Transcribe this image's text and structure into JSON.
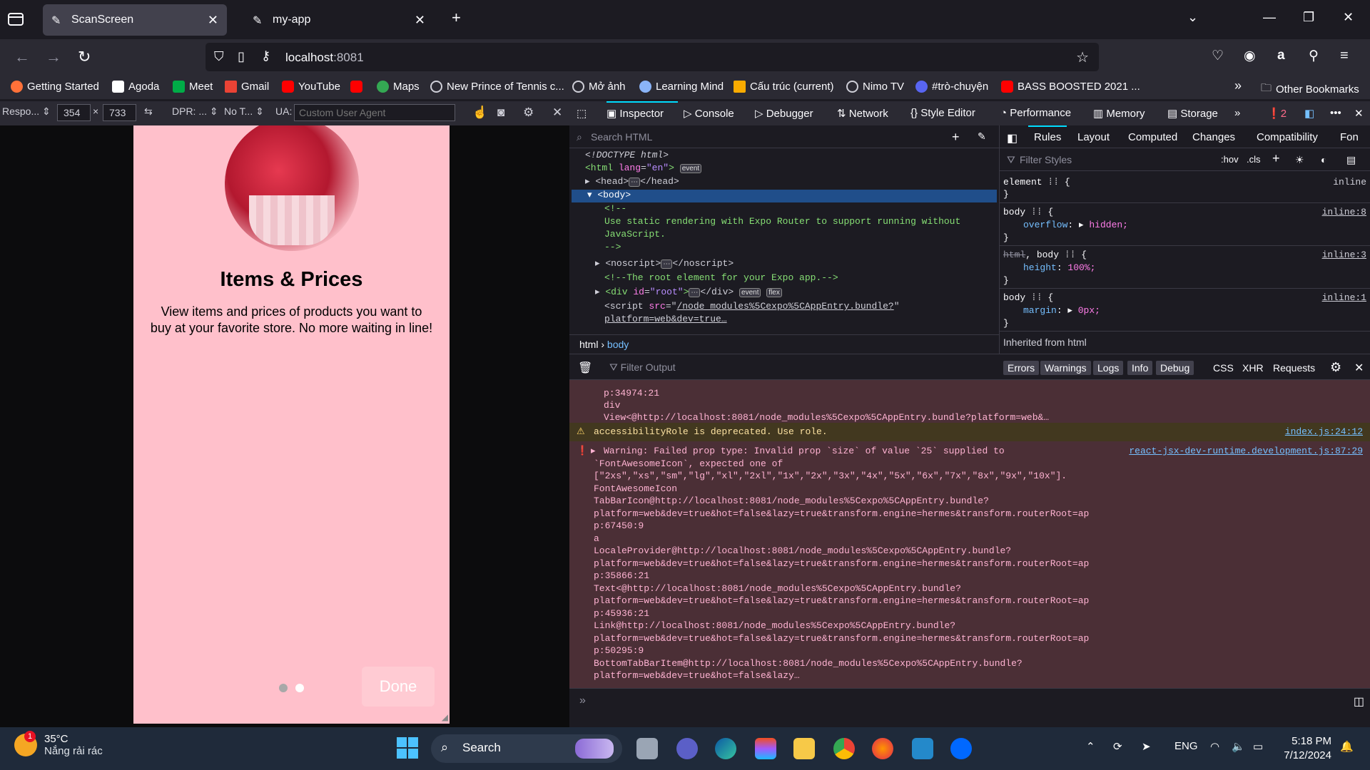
{
  "tabs": [
    {
      "title": "ScanScreen",
      "active": true
    },
    {
      "title": "my-app",
      "active": false
    }
  ],
  "address": {
    "host": "localhost",
    "port": ":8081"
  },
  "bookmarks": [
    {
      "label": "Getting Started",
      "color": "#ff7139"
    },
    {
      "label": "Agoda",
      "color": "#ffffff"
    },
    {
      "label": "Meet",
      "color": "#00ac47"
    },
    {
      "label": "Gmail",
      "color": "#ea4335"
    },
    {
      "label": "YouTube",
      "color": "#ff0000"
    },
    {
      "label": "",
      "color": "#ff0000"
    },
    {
      "label": "Maps",
      "color": "#34a853"
    },
    {
      "label": "New Prince of Tennis c...",
      "color": "#cfcfd8"
    },
    {
      "label": "Mở ảnh",
      "color": "#cfcfd8"
    },
    {
      "label": "Learning Mind",
      "color": "#8ab4f8"
    },
    {
      "label": "Cấu trúc (current)",
      "color": "#f9ab00"
    },
    {
      "label": "Nimo TV",
      "color": "#cfcfd8"
    },
    {
      "label": "#trò-chuyện",
      "color": "#5865f2"
    },
    {
      "label": "BASS BOOSTED 2021 ...",
      "color": "#ff0000"
    }
  ],
  "other_bookmarks": "Other Bookmarks",
  "rdm": {
    "device": "Respo...",
    "width": "354",
    "times": "×",
    "height": "733",
    "dpr": "DPR: ...",
    "throttle": "No T...",
    "ua_label": "UA:",
    "ua_placeholder": "Custom User Agent"
  },
  "app": {
    "title": "Items & Prices",
    "description": "View items and prices of products you want to buy at your favorite store. No more waiting in line!",
    "done_label": "Done",
    "page_index": 1,
    "page_count": 2
  },
  "devtools": {
    "tabs": [
      "Inspector",
      "Console",
      "Debugger",
      "Network",
      "Style Editor",
      "Performance",
      "Memory",
      "Storage"
    ],
    "error_count": "2",
    "search_placeholder": "Search HTML",
    "breadcrumb": [
      "html",
      "body"
    ],
    "rules_tabs": [
      "Rules",
      "Layout",
      "Computed",
      "Changes",
      "Compatibility",
      "Fon"
    ],
    "filter_styles": "Filter Styles",
    "hov": ":hov",
    "cls": ".cls",
    "inherited": "Inherited from html",
    "rules": [
      {
        "selector": "element",
        "src": "inline",
        "prop": "",
        "val": ""
      },
      {
        "selector": "body",
        "src": "inline:8",
        "prop": "overflow",
        "val": "hidden;"
      },
      {
        "selector": "html, body",
        "src": "inline:3",
        "prop": "height",
        "val": "100%;"
      },
      {
        "selector": "body",
        "src": "inline:1",
        "prop": "margin",
        "val": "0px;"
      }
    ]
  },
  "markup": {
    "doctype": "<!DOCTYPE html>",
    "comment1": "Use static rendering with Expo Router to support running without",
    "comment2": "JavaScript.",
    "comment3": "<!--The root element for your Expo app.-->",
    "script1": "/node_modules%5Cexpo%5CAppEntry.bundle?",
    "script2": "platform=web&dev=true…"
  },
  "console": {
    "filter_placeholder": "Filter Output",
    "levels": [
      "Errors",
      "Warnings",
      "Logs",
      "Info",
      "Debug"
    ],
    "extra": [
      "CSS",
      "XHR",
      "Requests"
    ],
    "top_lines": [
      "p:34974:21",
      "div",
      "View<@http://localhost:8081/node_modules%5Cexpo%5CAppEntry.bundle?platform=web&…"
    ],
    "warning": "accessibilityRole is deprecated. Use role.",
    "warning_src": "index.js:24:12",
    "error_src": "react-jsx-dev-runtime.development.js:87:29",
    "error_lines": [
      "Warning: Failed prop type: Invalid prop `size` of value `25` supplied to",
      "`FontAwesomeIcon`, expected one of",
      "[\"2xs\",\"xs\",\"sm\",\"lg\",\"xl\",\"2xl\",\"1x\",\"2x\",\"3x\",\"4x\",\"5x\",\"6x\",\"7x\",\"8x\",\"9x\",\"10x\"].",
      "FontAwesomeIcon",
      "TabBarIcon@http://localhost:8081/node_modules%5Cexpo%5CAppEntry.bundle?",
      "platform=web&dev=true&hot=false&lazy=true&transform.engine=hermes&transform.routerRoot=ap",
      "p:67450:9",
      "a",
      "LocaleProvider@http://localhost:8081/node_modules%5Cexpo%5CAppEntry.bundle?",
      "platform=web&dev=true&hot=false&lazy=true&transform.engine=hermes&transform.routerRoot=ap",
      "p:35866:21",
      "Text<@http://localhost:8081/node_modules%5Cexpo%5CAppEntry.bundle?",
      "platform=web&dev=true&hot=false&lazy=true&transform.engine=hermes&transform.routerRoot=ap",
      "p:45936:21",
      "Link@http://localhost:8081/node_modules%5Cexpo%5CAppEntry.bundle?",
      "platform=web&dev=true&hot=false&lazy=true&transform.engine=hermes&transform.routerRoot=ap",
      "p:50295:9",
      "BottomTabBarItem@http://localhost:8081/node_modules%5Cexpo%5CAppEntry.bundle?",
      "platform=web&dev=true&hot=false&lazy…"
    ]
  },
  "taskbar": {
    "temp": "35°C",
    "weather": "Nắng rải rác",
    "weather_badge": "1",
    "search": "Search",
    "lang": "ENG",
    "time": "5:18 PM",
    "date": "7/12/2024"
  }
}
